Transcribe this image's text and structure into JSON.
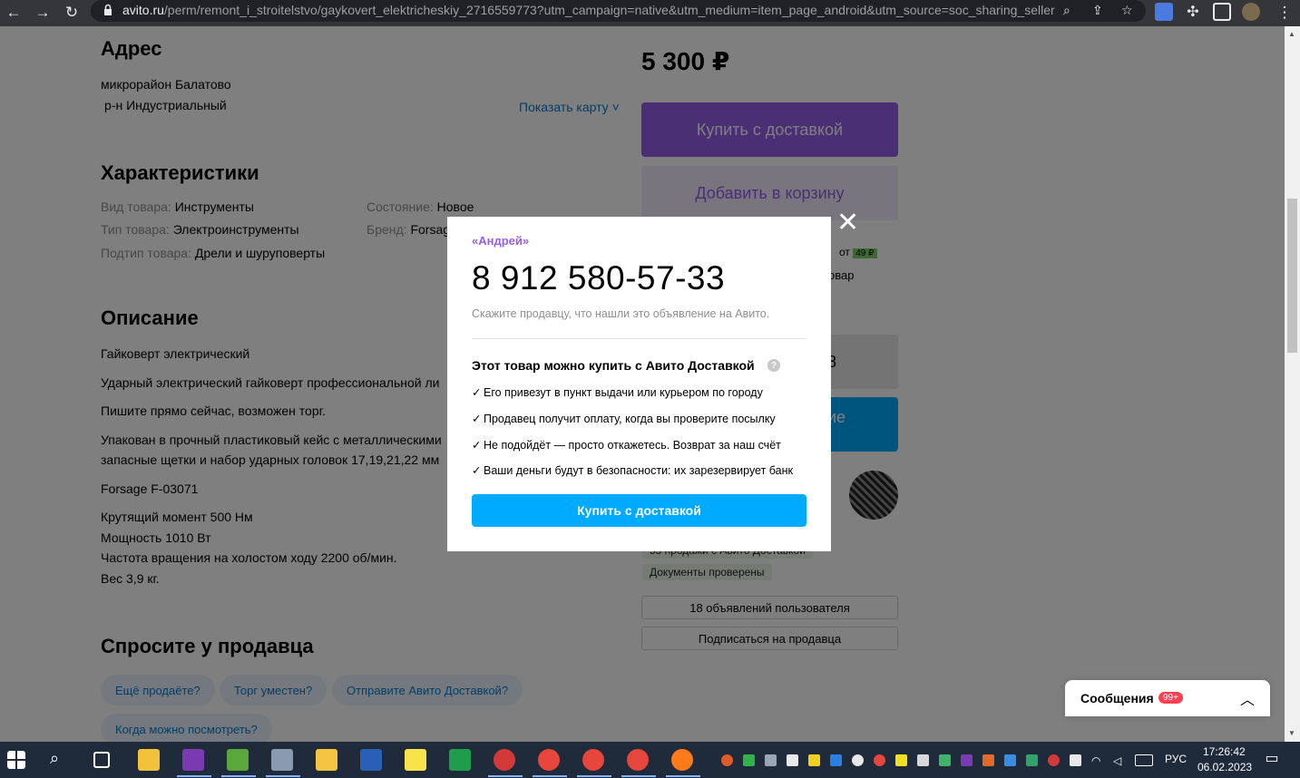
{
  "browser": {
    "url_host": "avito.ru",
    "url_path": "/perm/remont_i_stroitelstvo/gaykovert_elektricheskiy_2716559773?utm_campaign=native&utm_medium=item_page_android&utm_source=soc_sharing_seller"
  },
  "page": {
    "address_title": "Адрес",
    "address_line1": "микрорайон Балатово",
    "address_line2": "р-н Индустриальный",
    "show_map": "Показать карту",
    "characteristics_title": "Характеристики",
    "chars": [
      {
        "label": "Вид товара:",
        "value": "Инструменты"
      },
      {
        "label": "Тип товара:",
        "value": "Электроинструменты"
      },
      {
        "label": "Подтип товара:",
        "value": "Дрели и шуруповерты"
      },
      {
        "label": "Состояние:",
        "value": "Новое"
      },
      {
        "label": "Бренд:",
        "value": "Forsage"
      }
    ],
    "description_title": "Описание",
    "desc": [
      "Гайковерт электрический",
      "Ударный электрический гайковерт профессиональной ли",
      "Пишите прямо сейчас, возможен торг.",
      "Упакован в прочный пластиковый кейс с металлическими",
      "запасные щетки и набор ударных головок 17,19,21,22 мм",
      "Forsage F-03071",
      "Крутящий момент 500 Нм",
      "Мощность 1010 Вт",
      "Частота вращения на холостом ходу 2200 об/мин.",
      "Вес 3,9 кг."
    ],
    "ask_title": "Спросите у продавца",
    "ask_chips": [
      "Ещё продаёте?",
      "Торг уместен?",
      "Отправите Авито Доставкой?",
      "Когда можно посмотреть?"
    ],
    "price": "5 300 ₽",
    "buy_delivery": "Купить с доставкой",
    "add_cart": "Добавить в корзину",
    "partial_from": "от",
    "partial_fee": "49 ₽",
    "partial_item": "овар",
    "partial_blue": "ие",
    "partial_grey": "8",
    "tag_sales": "55 продажи с Авито Доставкой",
    "tag_docs": "Документы проверены",
    "user_ads": "18 объявлений пользователя",
    "subscribe": "Подписаться на продавца",
    "messages_label": "Сообщения",
    "messages_badge": "99+"
  },
  "modal": {
    "seller": "«Андрей»",
    "phone": "8 912 580-57-33",
    "hint": "Скажите продавцу, что нашли это объявление на Авито.",
    "delivery_title": "Этот товар можно купить с Авито Доставкой",
    "features": [
      "Его привезут в пункт выдачи или курьером по городу",
      "Продавец получит оплату, когда вы проверите посылку",
      "Не подойдёт — просто откажетесь. Возврат за наш счёт",
      "Ваши деньги будут в безопасности: их зарезервирует банк"
    ],
    "cta": "Купить с доставкой"
  },
  "taskbar": {
    "lang": "РУС",
    "time": "17:26:42",
    "date": "06.02.2023"
  },
  "colors": {
    "accent_purple": "#965eeb",
    "accent_blue": "#00aaff",
    "link_blue": "#0a7acb"
  }
}
